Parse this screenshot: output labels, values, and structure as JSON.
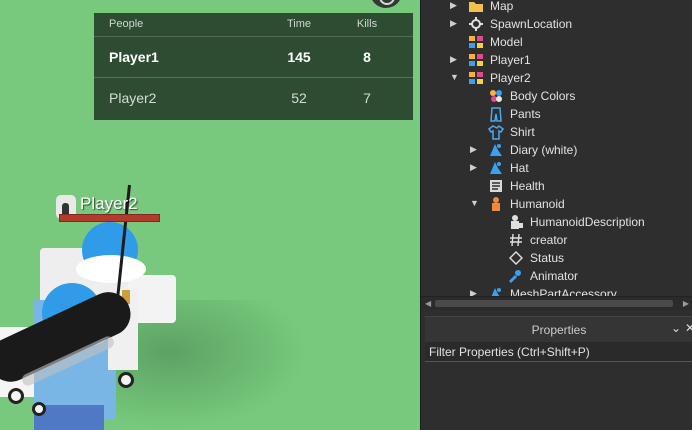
{
  "leaderboard": {
    "headers": {
      "people": "People",
      "time": "Time",
      "kills": "Kills"
    },
    "rows": [
      {
        "name": "Player1",
        "time": "145",
        "kills": "8"
      },
      {
        "name": "Player2",
        "time": "52",
        "kills": "7"
      }
    ]
  },
  "nametag": {
    "name": "Player2",
    "health_fraction": 1.0
  },
  "explorer": {
    "items": [
      {
        "label": "Map",
        "icon": "folder-icon"
      },
      {
        "label": "SpawnLocation",
        "icon": "spawn-icon"
      },
      {
        "label": "Model",
        "icon": "model-icon"
      },
      {
        "label": "Player1",
        "icon": "model-icon"
      },
      {
        "label": "Player2",
        "icon": "model-icon"
      },
      {
        "label": "Body Colors",
        "icon": "body-colors-icon"
      },
      {
        "label": "Pants",
        "icon": "pants-icon"
      },
      {
        "label": "Shirt",
        "icon": "shirt-icon"
      },
      {
        "label": "Diary (white)",
        "icon": "accessory-icon"
      },
      {
        "label": "Hat",
        "icon": "accessory-icon"
      },
      {
        "label": "Health",
        "icon": "script-icon"
      },
      {
        "label": "Humanoid",
        "icon": "humanoid-icon"
      },
      {
        "label": "HumanoidDescription",
        "icon": "humanoid-description-icon"
      },
      {
        "label": "creator",
        "icon": "value-icon"
      },
      {
        "label": "Status",
        "icon": "configuration-icon"
      },
      {
        "label": "Animator",
        "icon": "animator-icon"
      },
      {
        "label": "MeshPartAccessory",
        "icon": "accessory-icon"
      }
    ]
  },
  "properties": {
    "title": "Properties",
    "filter_placeholder": "Filter Properties (Ctrl+Shift+P)"
  },
  "colors": {
    "viewport_grass": "#78c97d",
    "panel_bg": "#2e2e2e",
    "accent_blue": "#2f9be9",
    "health_red": "#c74b3c"
  }
}
